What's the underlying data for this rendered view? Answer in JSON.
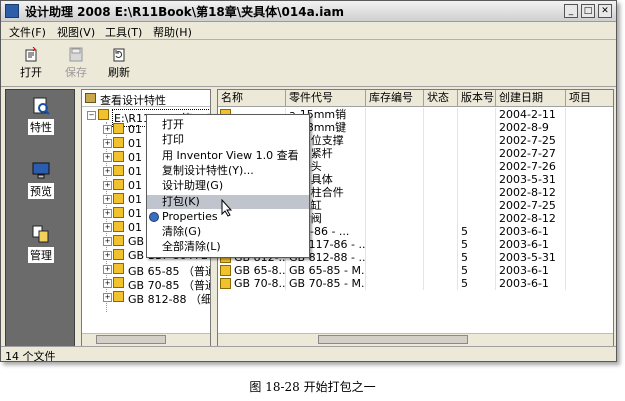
{
  "window": {
    "title": "设计助理 2008 E:\\R11Book\\第18章\\夹具体\\014a.iam"
  },
  "menu": [
    "文件(F)",
    "视图(V)",
    "工具(T)",
    "帮助(H)"
  ],
  "toolbar": {
    "open": "打开",
    "save": "保存",
    "refresh": "刷新"
  },
  "left_panel": {
    "props": "特性",
    "preview": "预览",
    "manage": "管理"
  },
  "tree": {
    "header": "查看设计特性",
    "root": "E:\\R11Book\\第18章\\夹具体\\014a.iam",
    "rows": [
      "01",
      "01",
      "01",
      "01",
      "01",
      "01",
      "01",
      "01",
      "GB",
      "GB 117-86 A 20",
      "GB 65-85 （普通",
      "GB 70-85 （普通",
      "GB 812-88 （细牙"
    ]
  },
  "grid": {
    "headers": [
      "名称",
      "零件代号",
      "库存编号",
      "状态",
      "版本号",
      "创建日期",
      "项目"
    ],
    "rows": [
      {
        "name": "",
        "code": "a-15mm销",
        "ver": "",
        "date": "2004-2-11"
      },
      {
        "name": "",
        "code": "a-18mm键",
        "ver": "",
        "date": "2002-8-9"
      },
      {
        "name": "",
        "code": "a-定位支撑",
        "ver": "",
        "date": "2002-7-25"
      },
      {
        "name": "",
        "code": "a-夹紧杆",
        "ver": "",
        "date": "2002-7-27"
      },
      {
        "name": "",
        "code": "a-接头",
        "ver": "",
        "date": "2002-7-26"
      },
      {
        "name": "",
        "code": "a-夹具体",
        "ver": "",
        "date": "2003-5-31"
      },
      {
        "name": "",
        "code": "a-螺柱合件",
        "ver": "",
        "date": "2002-8-12"
      },
      {
        "name": "",
        "code": "a-气缸",
        "ver": "",
        "date": "2002-7-25"
      },
      {
        "name": "",
        "code": "a-转阀",
        "ver": "",
        "date": "2002-8-12"
      },
      {
        "name": "",
        "code": "117-86 - ...",
        "ver": "5",
        "date": "2003-6-1"
      },
      {
        "name": "GB 117-...",
        "code": "GB 117-86 - ...",
        "ver": "5",
        "date": "2003-6-1"
      },
      {
        "name": "GB 812-...",
        "code": "GB 812-88 - ...",
        "ver": "5",
        "date": "2003-5-31"
      },
      {
        "name": "GB 65-8...",
        "code": "GB 65-85 - M...",
        "ver": "5",
        "date": "2003-6-1"
      },
      {
        "name": "GB 70-8...",
        "code": "GB 70-85 - M...",
        "ver": "5",
        "date": "2003-6-1"
      }
    ]
  },
  "context_menu": [
    "打开",
    "打印",
    "用 Inventor View 1.0 查看",
    "复制设计特性(Y)...",
    "设计助理(G)",
    "打包(K)",
    "Properties",
    "清除(G)",
    "全部清除(L)"
  ],
  "status": "14 个文件",
  "caption": "图 18-28  开始打包之一"
}
